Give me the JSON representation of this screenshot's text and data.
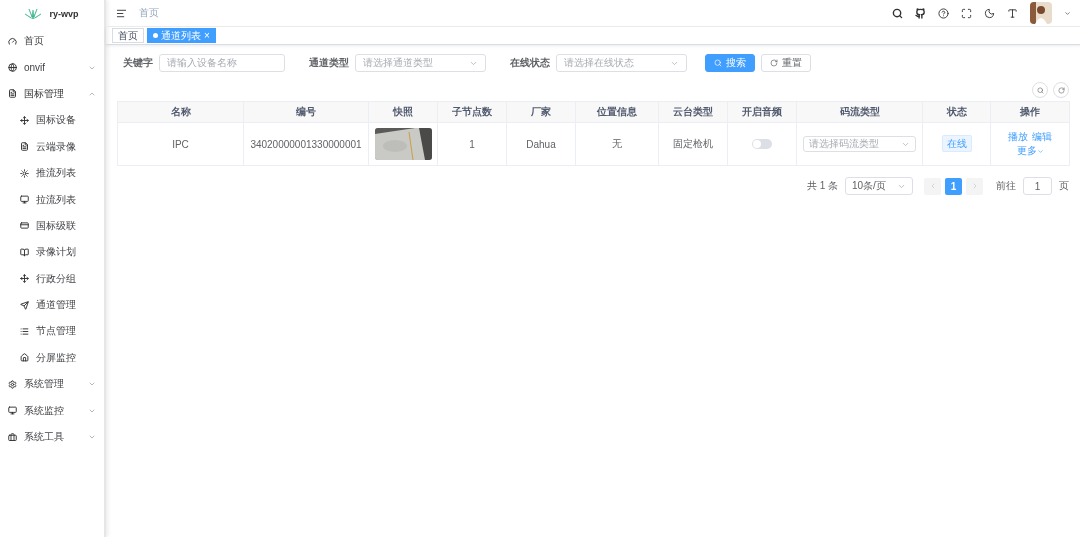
{
  "app": {
    "title": "ry-wvp"
  },
  "sidebar": {
    "items": [
      {
        "label": "首页"
      },
      {
        "label": "onvif",
        "expanded": false
      },
      {
        "label": "国标管理",
        "expanded": true,
        "children": [
          {
            "label": "国标设备"
          },
          {
            "label": "云端录像"
          },
          {
            "label": "推流列表"
          },
          {
            "label": "拉流列表"
          },
          {
            "label": "国标级联"
          },
          {
            "label": "录像计划"
          },
          {
            "label": "行政分组"
          },
          {
            "label": "通道管理"
          },
          {
            "label": "节点管理"
          },
          {
            "label": "分屏监控"
          }
        ]
      },
      {
        "label": "系统管理",
        "expanded": false
      },
      {
        "label": "系统监控",
        "expanded": false
      },
      {
        "label": "系统工具",
        "expanded": false
      }
    ]
  },
  "breadcrumb": [
    "首页"
  ],
  "tabs": [
    {
      "label": "首页",
      "selected": false
    },
    {
      "label": "通道列表",
      "selected": true
    }
  ],
  "tab_close": "×",
  "filters": [
    {
      "label": "关键字",
      "placeholder": "请输入设备名称",
      "kind": "input"
    },
    {
      "label": "通道类型",
      "placeholder": "请选择通道类型",
      "kind": "select"
    },
    {
      "label": "在线状态",
      "placeholder": "请选择在线状态",
      "kind": "select"
    }
  ],
  "buttons": {
    "search": "搜索",
    "reset": "重置"
  },
  "table": {
    "columns": [
      "名称",
      "编号",
      "快照",
      "子节点数",
      "厂家",
      "位置信息",
      "云台类型",
      "开启音频",
      "码流类型",
      "状态",
      "操作"
    ],
    "rows": [
      {
        "name": "IPC",
        "id": "34020000001330000001",
        "children": "1",
        "vendor": "Dahua",
        "location": "无",
        "ptz": "固定枪机",
        "audio_on": false,
        "stream_placeholder": "请选择码流类型",
        "status": "在线",
        "actions": [
          "播放",
          "编辑",
          "更多"
        ]
      }
    ]
  },
  "pagination": {
    "total": "共 1 条",
    "page_size": "10条/页",
    "pages": [
      {
        "label": "1",
        "selected": true
      }
    ],
    "goto_label": "前往",
    "goto_value": "1",
    "goto_suffix": "页"
  }
}
